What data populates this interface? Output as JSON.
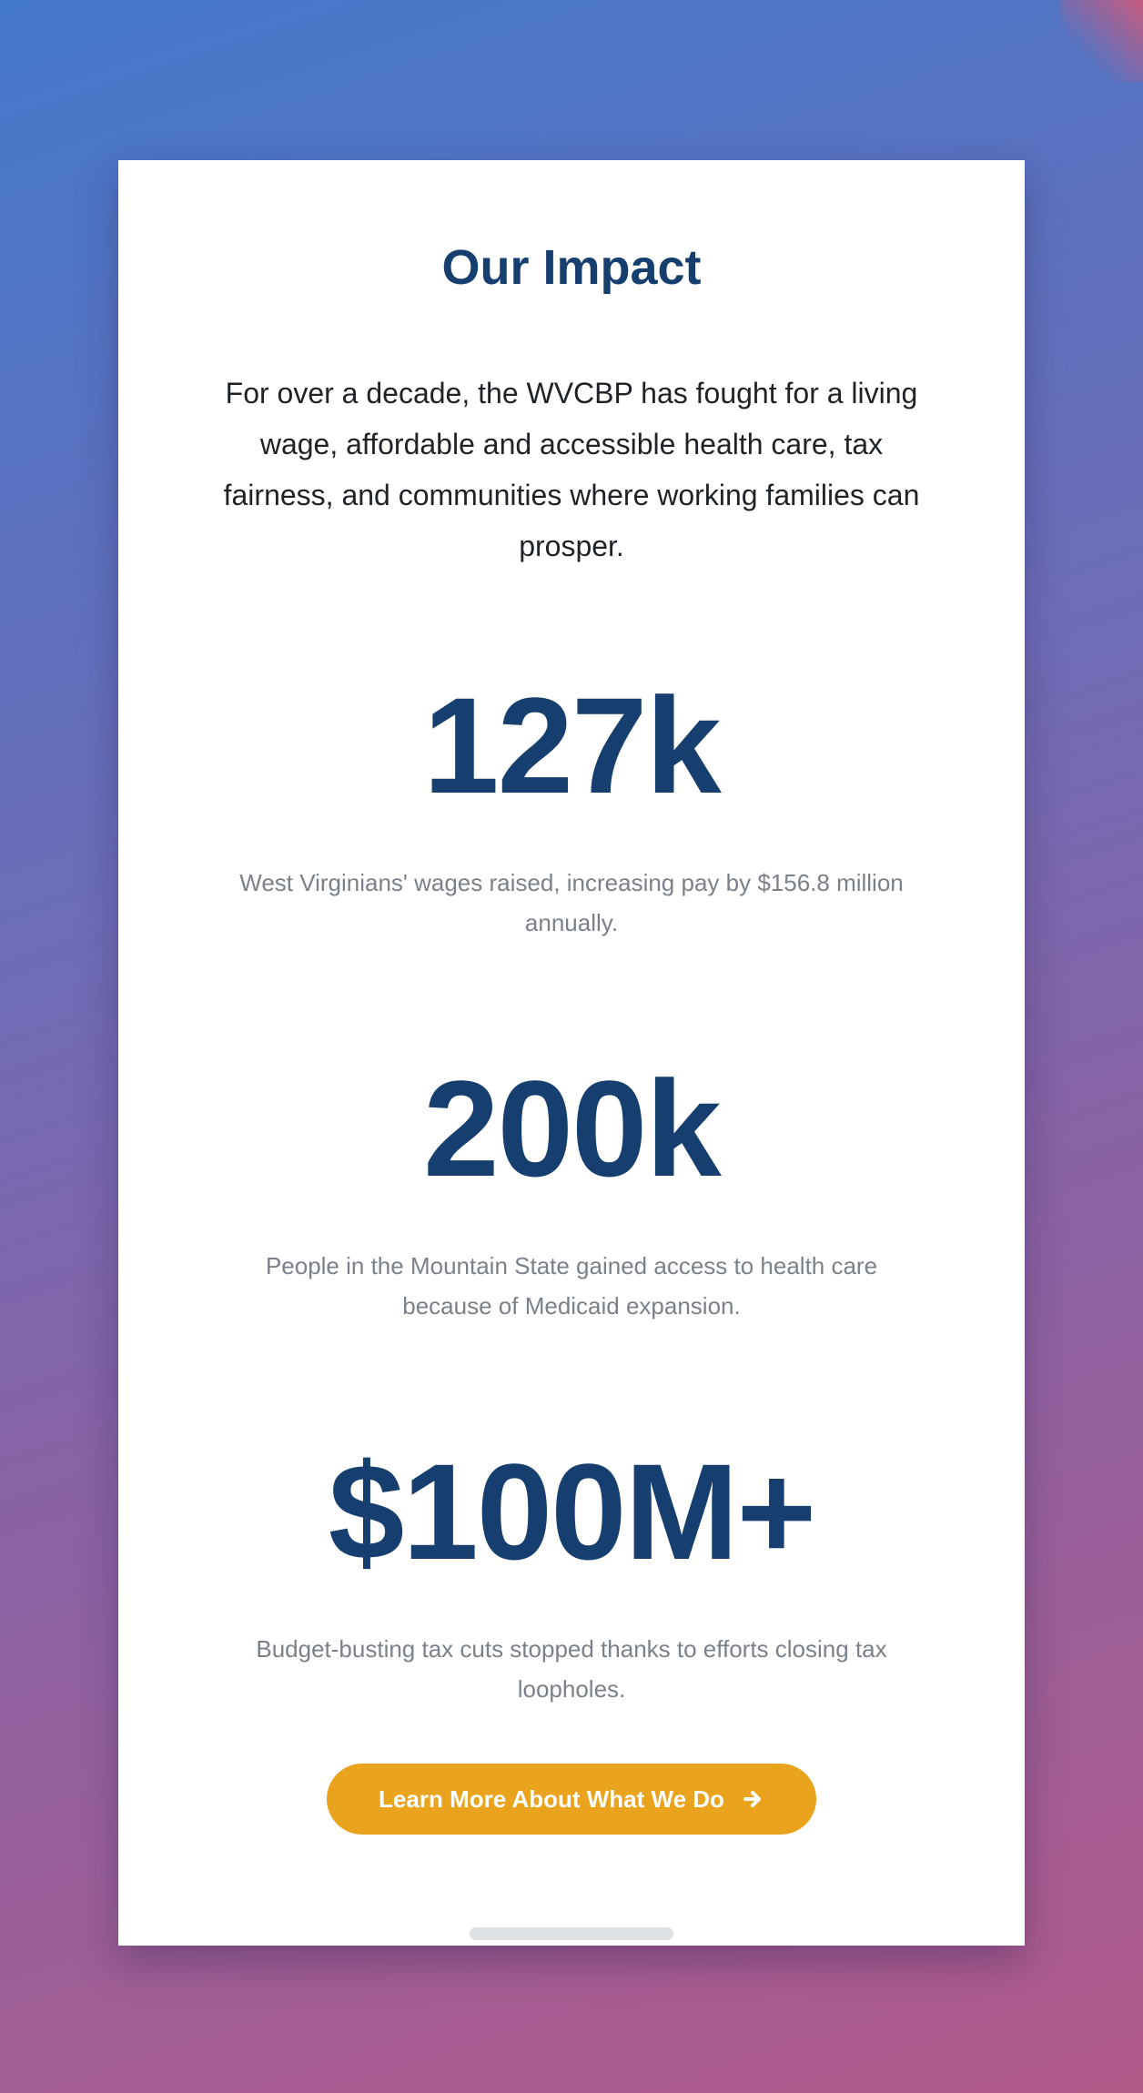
{
  "section": {
    "title": "Our Impact",
    "intro": "For over a decade, the WVCBP has fought for a living wage, affordable and accessible health care, tax fairness, and communities where working families can prosper."
  },
  "stats": [
    {
      "value": "127k",
      "description": "West Virginians' wages raised, increasing pay by $156.8 million annually."
    },
    {
      "value": "200k",
      "description": "People in the Mountain State gained access to health care because of Medicaid expansion."
    },
    {
      "value": "$100M+",
      "description": "Budget-busting tax cuts stopped thanks to efforts closing tax loopholes."
    }
  ],
  "cta": {
    "label": "Learn More About What We Do",
    "icon": "arrow-right-icon"
  },
  "colors": {
    "heading": "#163f6f",
    "cta_background": "#e9a31c",
    "description_text": "#7b8189"
  }
}
